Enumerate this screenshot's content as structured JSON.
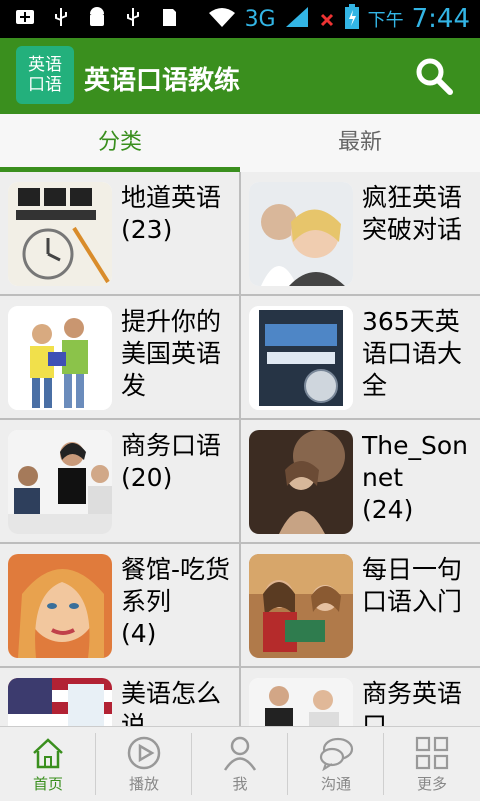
{
  "statusbar": {
    "network": "3G",
    "ampm": "下午",
    "time": "7:44"
  },
  "app": {
    "logo_line1": "英语",
    "logo_line2": "口语",
    "title": "英语口语教练"
  },
  "tabs": [
    {
      "label": "分类"
    },
    {
      "label": "最新"
    }
  ],
  "grid": [
    {
      "title": "地道英语",
      "count": "(23)"
    },
    {
      "title": "疯狂英语突破对话",
      "count": ""
    },
    {
      "title": "提升你的美国英语发",
      "count": ""
    },
    {
      "title": "365天英语口语大全",
      "count": ""
    },
    {
      "title": "商务口语",
      "count": "(20)"
    },
    {
      "title": "The_Sonnet",
      "count": "(24)"
    },
    {
      "title": "餐馆-吃货系列",
      "count": "(4)"
    },
    {
      "title": "每日一句口语入门",
      "count": ""
    },
    {
      "title": "美语怎么说",
      "count": ""
    },
    {
      "title": "商务英语口",
      "count": ""
    }
  ],
  "nav": [
    {
      "label": "首页"
    },
    {
      "label": "播放"
    },
    {
      "label": "我"
    },
    {
      "label": "沟通"
    },
    {
      "label": "更多"
    }
  ],
  "colors": {
    "brand": "#3a8f1e",
    "logo": "#23b07c",
    "status_accent": "#33b5e5"
  }
}
